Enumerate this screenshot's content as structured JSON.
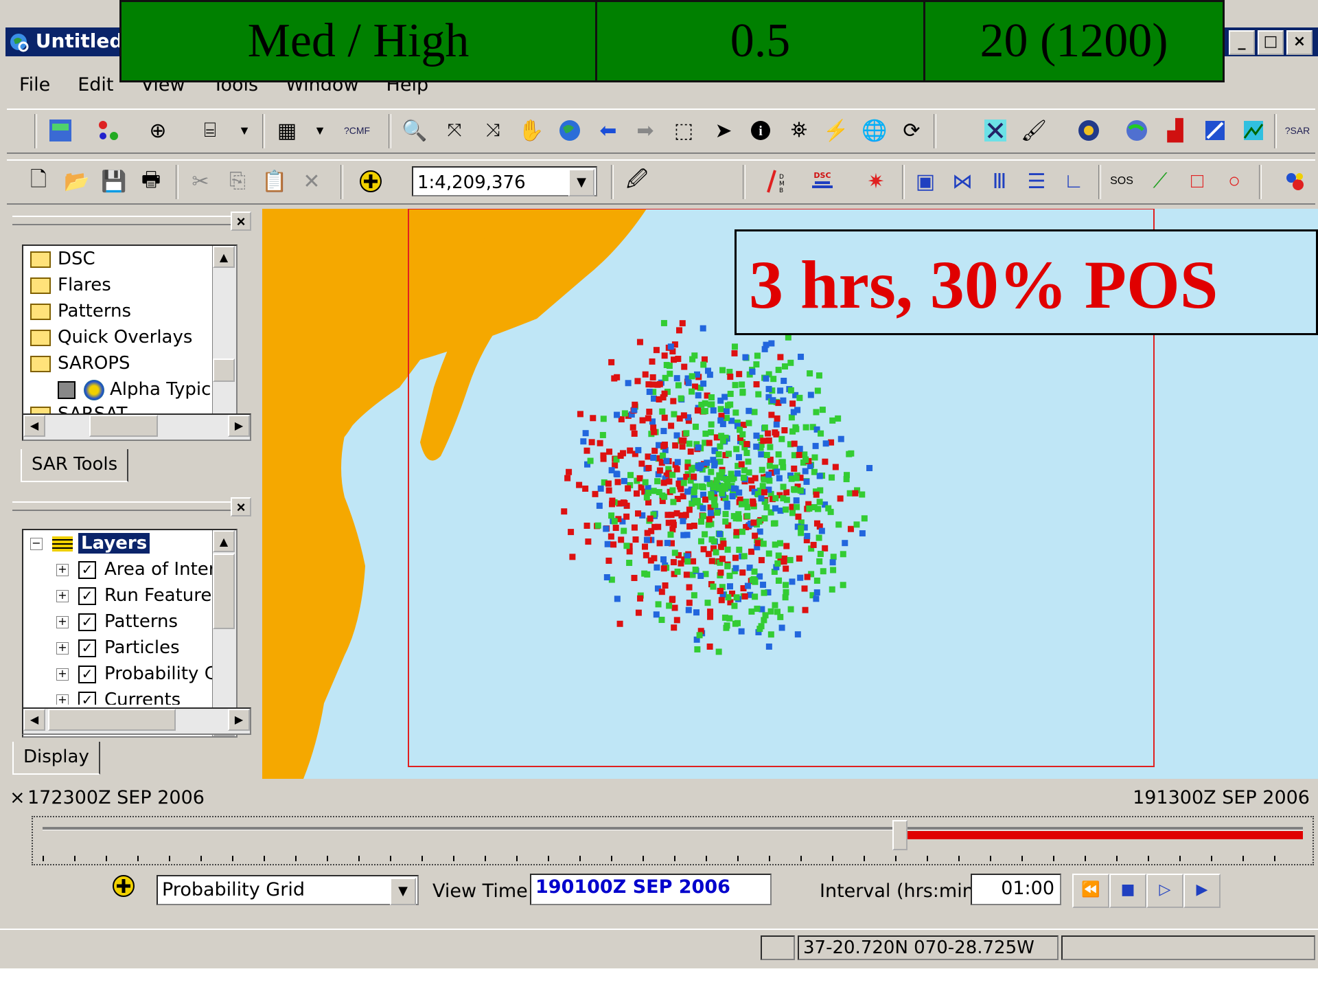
{
  "banner": {
    "col1": "Med / High",
    "col2": "0.5",
    "col3": "20 (1200)"
  },
  "window": {
    "title": "Untitled",
    "min": "_",
    "max": "□",
    "close": "×"
  },
  "menu": [
    "File",
    "Edit",
    "View",
    "Tools",
    "Window",
    "Help"
  ],
  "toolbar": {
    "scale": "1:4,209,376"
  },
  "sar_panel": {
    "items": [
      "DSC",
      "Flares",
      "Patterns",
      "Quick Overlays",
      "SAROPS",
      "Alpha Typica",
      "SARSAT"
    ],
    "tab": "SAR Tools"
  },
  "layers_panel": {
    "root": "Layers",
    "items": [
      "Area of Inter",
      "Run Features",
      "Patterns",
      "Particles",
      "Probability Gr",
      "Currents"
    ],
    "tab": "Display"
  },
  "overlay": {
    "text": "3 hrs, 30% POS",
    "color": "#e00000"
  },
  "timeline": {
    "start": "172300Z SEP 2006",
    "end": "191300Z SEP 2006",
    "position_fraction": 0.68,
    "layer_select": "Probability Grid",
    "view_time_label": "View Time",
    "view_time": "190100Z SEP 2006",
    "interval_label": "Interval (hrs:mins)",
    "interval": "01:00"
  },
  "status": {
    "coords": "37-20.720N 070-28.725W"
  },
  "colors": {
    "land": "#f5a800",
    "sea": "#bfe6f6",
    "particle_red": "#dd1111",
    "particle_green": "#33cc33",
    "particle_blue": "#2266dd"
  }
}
